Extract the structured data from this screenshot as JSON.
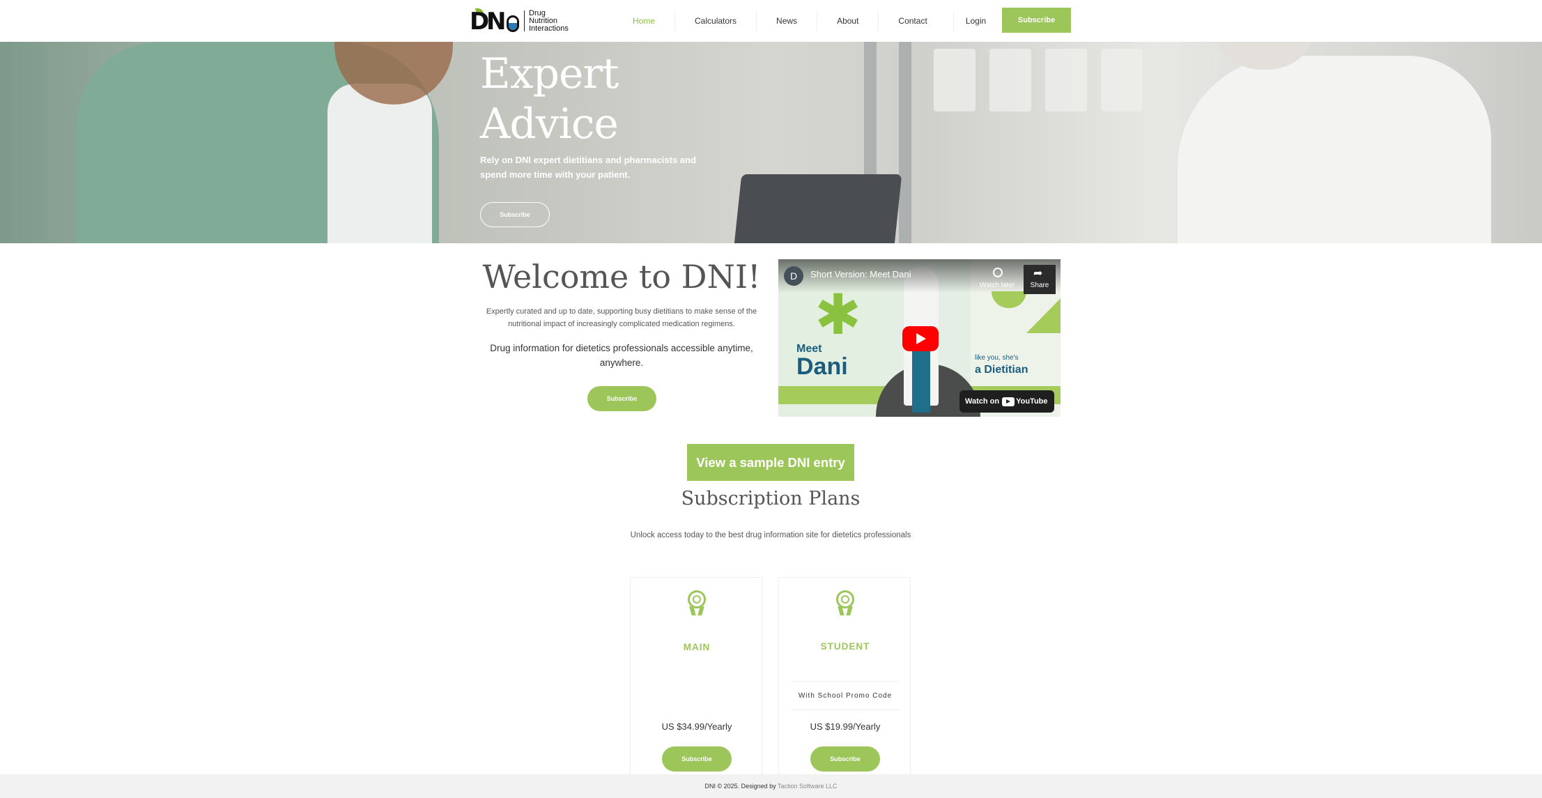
{
  "logo": {
    "mark_d": "D",
    "mark_n": "N",
    "text_line1": "Drug",
    "text_line2": "Nutrition",
    "text_line3": "Interactions"
  },
  "nav": {
    "items": [
      {
        "label": "Home",
        "active": true
      },
      {
        "label": "Calculators"
      },
      {
        "label": "News"
      },
      {
        "label": "About"
      },
      {
        "label": "Contact"
      }
    ],
    "login": "Login",
    "subscribe": "Subscribe"
  },
  "hero": {
    "title_line1": "Expert",
    "title_line2": "Advice",
    "subtitle": "Rely on DNI expert dietitians and pharmacists and spend more time with your patient.",
    "button": "Subscribe"
  },
  "welcome": {
    "title": "Welcome to DNI!",
    "paragraph": "Expertly curated and up to date, supporting busy dietitians to make sense of the nutritional impact of increasingly complicated medication regimens.",
    "tagline": "Drug information for dietetics professionals accessible anytime, anywhere.",
    "button": "Subscribe"
  },
  "video": {
    "channel_initial": "D",
    "title": "Short Version: Meet Dani",
    "watch_later": "Watch later",
    "share": "Share",
    "meet": "Meet",
    "dani": "Dani",
    "like_you": "like you, she's",
    "dietitian": "a Dietitian",
    "watch_on": "Watch on",
    "youtube": "YouTube"
  },
  "sample_button": "View a sample DNI entry",
  "plans": {
    "title": "Subscription Plans",
    "subtitle": "Unlock access today to the best drug information site for dietetics professionals",
    "cards": [
      {
        "name": "MAIN",
        "promo": "",
        "price": "US $34.99/Yearly",
        "button": "Subscribe"
      },
      {
        "name": "STUDENT",
        "promo": "With School Promo Code",
        "price": "US $19.99/Yearly",
        "button": "Subscribe"
      }
    ]
  },
  "footer": {
    "text": "DNI © 2025. Designed by",
    "link": "Taction Software LLC"
  },
  "colors": {
    "accent": "#9cc65a",
    "nav_active": "#8bc34a",
    "footer_bg": "#f2f2f2"
  }
}
